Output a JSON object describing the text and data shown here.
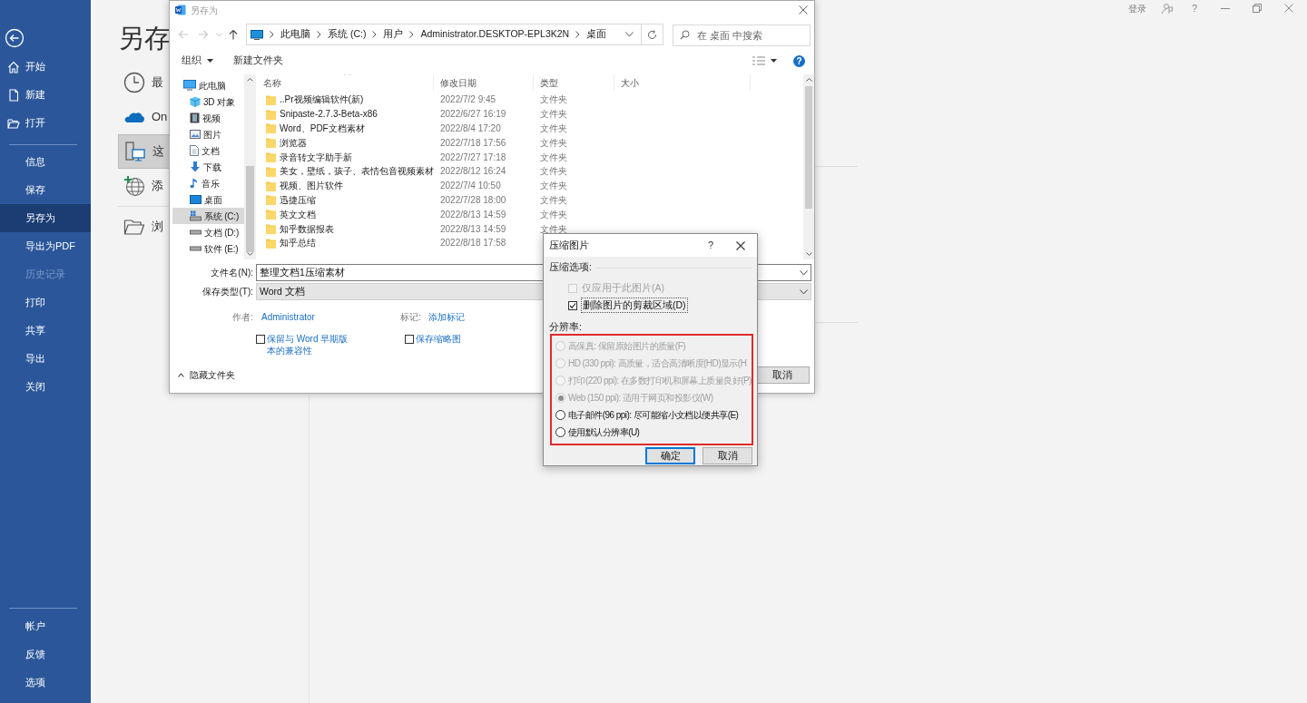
{
  "word": {
    "sidebar": {
      "top_items": [
        {
          "label": "开始",
          "kind": "home",
          "selected": false
        },
        {
          "label": "新建",
          "kind": "new",
          "selected": false
        },
        {
          "label": "打开",
          "kind": "open",
          "selected": false
        }
      ],
      "items": [
        {
          "label": "信息",
          "selected": false,
          "disabled": false
        },
        {
          "label": "保存",
          "selected": false,
          "disabled": false
        },
        {
          "label": "另存为",
          "selected": true,
          "disabled": false
        },
        {
          "label": "导出为PDF",
          "selected": false,
          "disabled": false
        },
        {
          "label": "历史记录",
          "selected": false,
          "disabled": true
        },
        {
          "label": "打印",
          "selected": false,
          "disabled": false
        },
        {
          "label": "共享",
          "selected": false,
          "disabled": false
        },
        {
          "label": "导出",
          "selected": false,
          "disabled": false
        },
        {
          "label": "关闭",
          "selected": false,
          "disabled": false
        }
      ],
      "bottom_items": [
        {
          "label": "帐户",
          "selected": false
        },
        {
          "label": "反馈",
          "selected": false
        },
        {
          "label": "选项",
          "selected": false
        }
      ]
    },
    "page_title": "另存",
    "locations": [
      {
        "kind": "recent",
        "label": "最",
        "selected": false
      },
      {
        "kind": "onedrive",
        "label": "On",
        "selected": false
      },
      {
        "kind": "computer",
        "label": "这",
        "selected": true
      },
      {
        "kind": "add_place",
        "label": "添",
        "selected": false
      },
      {
        "kind": "browse",
        "label": "浏",
        "selected": false
      }
    ],
    "title_bar": {
      "sign_in": "登录",
      "help": "?"
    }
  },
  "save_dialog": {
    "title": "另存为",
    "breadcrumb": [
      "此电脑",
      "系统 (C:)",
      "用户",
      "Administrator.DESKTOP-EPL3K2N",
      "桌面"
    ],
    "search": {
      "placeholder": "在 桌面 中搜索"
    },
    "toolbar": {
      "organize": "组织",
      "new_folder": "新建文件夹",
      "help": "?"
    },
    "nav": [
      {
        "label": "此电脑",
        "kind": "computer",
        "selected": false,
        "children": [
          {
            "label": "3D 对象",
            "kind": "objects",
            "selected": false
          },
          {
            "label": "视频",
            "kind": "videos",
            "selected": false
          },
          {
            "label": "图片",
            "kind": "pictures",
            "selected": false
          },
          {
            "label": "文档",
            "kind": "documents",
            "selected": false
          },
          {
            "label": "下载",
            "kind": "downloads",
            "selected": false
          },
          {
            "label": "音乐",
            "kind": "music",
            "selected": false
          },
          {
            "label": "桌面",
            "kind": "desktop",
            "selected": false
          },
          {
            "label": "系统 (C:)",
            "kind": "system_drive",
            "selected": true
          },
          {
            "label": "文档 (D:)",
            "kind": "drive",
            "selected": false
          },
          {
            "label": "软件 (E:)",
            "kind": "drive",
            "selected": false
          }
        ]
      }
    ],
    "columns": [
      "名称",
      "修改日期",
      "类型",
      "大小"
    ],
    "rows": [
      {
        "name": "..Pr视频编辑软件(新)",
        "date": "2022/7/2 9:45",
        "type": "文件夹"
      },
      {
        "name": "Snipaste-2.7.3-Beta-x86",
        "date": "2022/6/27 16:19",
        "type": "文件夹"
      },
      {
        "name": "Word、PDF文档素材",
        "date": "2022/8/4 17:20",
        "type": "文件夹"
      },
      {
        "name": "浏览器",
        "date": "2022/7/18 17:56",
        "type": "文件夹"
      },
      {
        "name": "录音转文字助手新",
        "date": "2022/7/27 17:18",
        "type": "文件夹"
      },
      {
        "name": "美女，壁纸，孩子、表情包音视频素材",
        "date": "2022/8/12 16:24",
        "type": "文件夹"
      },
      {
        "name": "视频、图片软件",
        "date": "2022/7/4 10:50",
        "type": "文件夹"
      },
      {
        "name": "迅捷压缩",
        "date": "2022/7/28 18:00",
        "type": "文件夹"
      },
      {
        "name": "英文文档",
        "date": "2022/8/13 14:59",
        "type": "文件夹"
      },
      {
        "name": "知乎数据报表",
        "date": "2022/8/13 14:59",
        "type": "文件夹"
      },
      {
        "name": "知乎总结",
        "date": "2022/8/18 17:58"
      }
    ],
    "filename": {
      "label": "文件名(N):",
      "value": "整理文档1压缩素材"
    },
    "save_type": {
      "label": "保存类型(T):",
      "value": "Word 文档"
    },
    "author": {
      "label": "作者:",
      "value": "Administrator"
    },
    "tags": {
      "label": "标记:",
      "value": "添加标记"
    },
    "checkboxes": [
      {
        "label": "保留与 Word 早期版本的兼容性",
        "checked": false
      },
      {
        "label": "保存缩略图",
        "checked": false
      }
    ],
    "hide_folders": "隐藏文件夹",
    "cancel": "取消"
  },
  "compress_dialog": {
    "title": "压缩图片",
    "help": "?",
    "options_label": "压缩选项:",
    "options": [
      {
        "label": "仅应用于此图片(A)",
        "checked": false,
        "disabled": true
      },
      {
        "label": "删除图片的剪裁区域(D)",
        "checked": true,
        "disabled": false
      }
    ],
    "resolution_label": "分辨率:",
    "resolutions": [
      {
        "label": "高保真: 保留原始图片的质量(F)",
        "selected": false,
        "disabled": true
      },
      {
        "label": "HD (330 ppi): 高质量，适合高清晰度(HD)显示(H",
        "selected": false,
        "disabled": true
      },
      {
        "label": "打印(220 ppi): 在多数打印机和屏幕上质量良好(P)",
        "selected": false,
        "disabled": true
      },
      {
        "label": "Web (150 ppi): 适用于网页和投影仪(W)",
        "selected": true,
        "disabled": true
      },
      {
        "label": "电子邮件(96 ppi): 尽可能缩小文档以便共享(E)",
        "selected": false,
        "disabled": false
      },
      {
        "label": "使用默认分辨率(U)",
        "selected": false,
        "disabled": false
      }
    ],
    "ok": "确定",
    "cancel": "取消"
  }
}
